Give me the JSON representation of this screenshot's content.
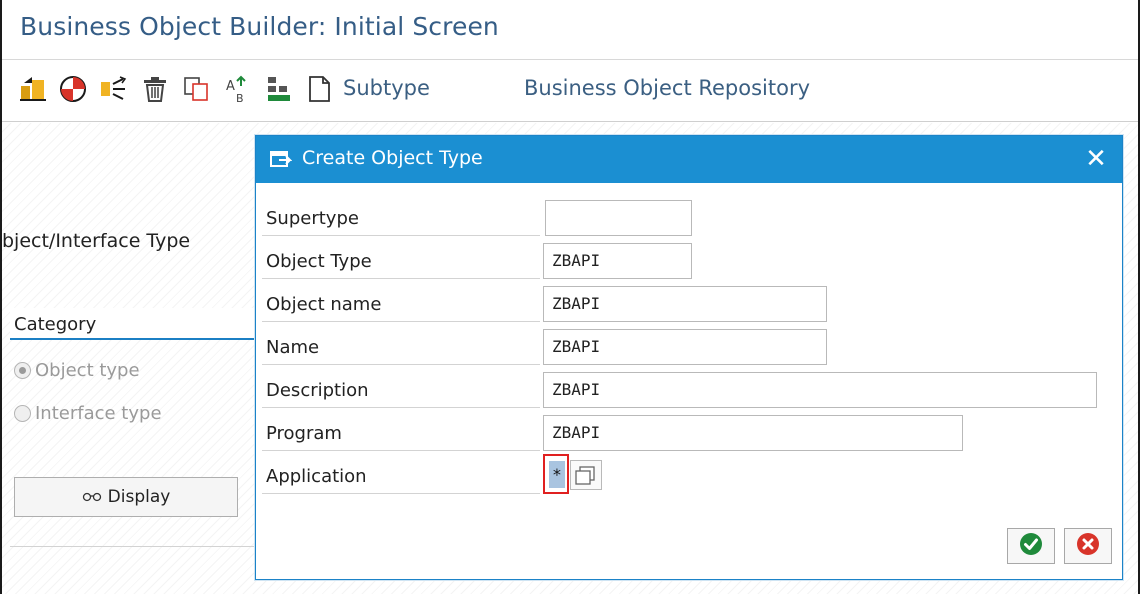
{
  "window": {
    "title": "Business Object Builder: Initial Screen"
  },
  "toolbar": {
    "icons": [
      "create-icon",
      "test-icon",
      "where-used-icon",
      "delete-icon",
      "copy-icon",
      "rename-icon",
      "hierarchy-icon",
      "document-icon"
    ],
    "subtype_label": "Subtype",
    "repository_label": "Business Object Repository"
  },
  "left": {
    "object_interface_label": "bject/Interface Type",
    "category_label": "Category",
    "radio_object": "Object type",
    "radio_interface": "Interface type",
    "radio_selected": "Object type",
    "display_label": "Display"
  },
  "dialog": {
    "title": "Create Object Type",
    "close_symbol": "✕",
    "fields": [
      {
        "label": "Supertype",
        "value": ""
      },
      {
        "label": "Object Type",
        "value": "ZBAPI"
      },
      {
        "label": "Object name",
        "value": "ZBAPI"
      },
      {
        "label": "Name",
        "value": "ZBAPI"
      },
      {
        "label": "Description",
        "value": "ZBAPI"
      },
      {
        "label": "Program",
        "value": "ZBAPI"
      },
      {
        "label": "Application",
        "value": "*"
      }
    ],
    "ok_icon": "checkmark-icon",
    "cancel_icon": "cancel-icon"
  },
  "colors": {
    "title_text": "#355d86",
    "dialog_header": "#1b8fd2",
    "focus_border": "#e02020",
    "ok_green": "#1f8a3b",
    "cancel_red": "#d8342a"
  }
}
